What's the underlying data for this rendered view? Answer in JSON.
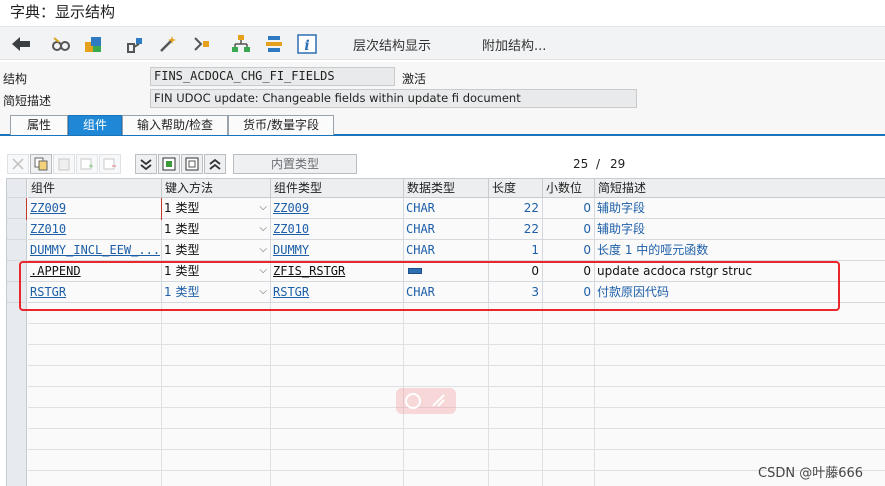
{
  "title": "字典：显示结构",
  "toolbar": {
    "nav_back_icon": "arrow-left-icon",
    "icons": [
      "glasses-icon",
      "object-list-icon",
      "tree-icon",
      "magic-wand-icon",
      "hierarchy-icon",
      "org-chart-icon",
      "stack-icon",
      "info-icon"
    ],
    "hierarchy_display_label": "层次结构显示",
    "append_structure_label": "附加结构..."
  },
  "header": {
    "structure_label": "结构",
    "structure_value": "FINS_ACDOCA_CHG_FI_FIELDS",
    "status": "激活",
    "short_desc_label": "简短描述",
    "short_desc_value": "FIN UDOC update: Changeable fields within update fi document"
  },
  "tabs": [
    {
      "label": "属性",
      "active": false
    },
    {
      "label": "组件",
      "active": true
    },
    {
      "label": "输入帮助/检查",
      "active": false
    },
    {
      "label": "货币/数量字段",
      "active": false
    }
  ],
  "table_toolbar": {
    "builtin_type_label": "内置类型",
    "counter_current": "25",
    "counter_sep": "/",
    "counter_total": "29"
  },
  "columns": [
    "组件",
    "键入方法",
    "组件类型",
    "数据类型",
    "长度",
    "小数位",
    "简短描述"
  ],
  "rows": [
    {
      "component": "ZZ009",
      "typing": "1 类型",
      "comp_type": "ZZ009",
      "data_type": "CHAR",
      "length": "22",
      "decimals": "0",
      "desc": "辅助字段"
    },
    {
      "component": "ZZ010",
      "typing": "1 类型",
      "comp_type": "ZZ010",
      "data_type": "CHAR",
      "length": "22",
      "decimals": "0",
      "desc": "辅助字段"
    },
    {
      "component": "DUMMY_INCL_EEW_...",
      "typing": "1 类型",
      "comp_type": "DUMMY",
      "data_type": "CHAR",
      "length": "1",
      "decimals": "0",
      "desc": "长度 1 中的哑元函数"
    },
    {
      "component": ".APPEND",
      "typing": "1 类型",
      "comp_type": "ZFIS_RSTGR",
      "data_type": "",
      "length": "0",
      "decimals": "0",
      "desc": "update acdoca rstgr struc"
    },
    {
      "component": "RSTGR",
      "typing": "1 类型",
      "comp_type": "RSTGR",
      "data_type": "CHAR",
      "length": "3",
      "decimals": "0",
      "desc": "付款原因代码"
    }
  ],
  "credit": "CSDN @叶藤666"
}
